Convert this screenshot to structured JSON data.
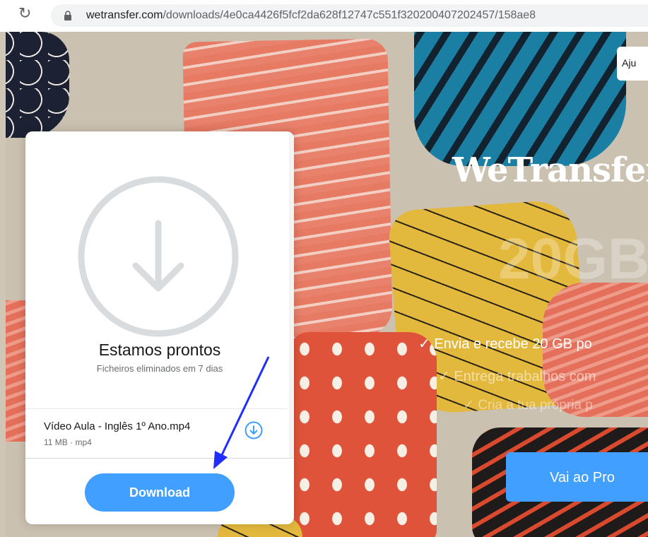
{
  "browser": {
    "url_host": "wetransfer.com",
    "url_path": "/downloads/4e0ca4426f5fcf2da628f12747c551f320200407202457/158ae8",
    "tab_peek": "...."
  },
  "site": {
    "brand": "WeTransfer",
    "help_label": "Aju",
    "promo_big": "20GB",
    "bullets": [
      "✓  Envia e recebe 20 GB po",
      "✓  Entrega trabalhos com",
      "✓  Cria a tua própria p"
    ],
    "pro_button": "Vai ao Pro"
  },
  "panel": {
    "title": "Estamos prontos",
    "subtitle": "Ficheiros eliminados em 7 dias",
    "file": {
      "name": "Vídeo Aula - Inglês 1º Ano.mp4",
      "meta": "11 MB · mp4"
    },
    "download_button": "Download"
  },
  "colors": {
    "accent": "#409fff",
    "annotation": "#1f2dff"
  }
}
